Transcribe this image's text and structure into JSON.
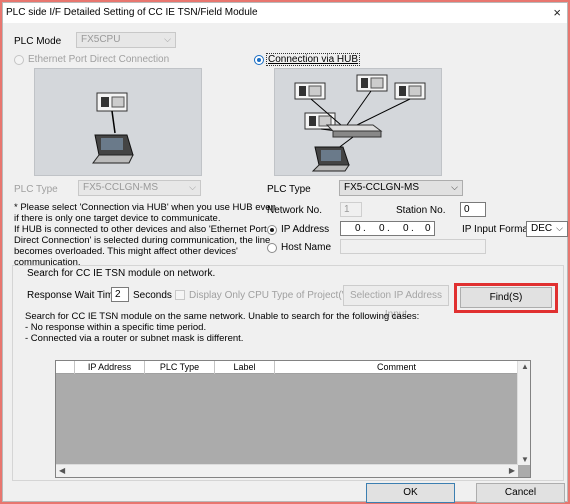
{
  "window": {
    "title": "PLC side I/F Detailed Setting of CC IE TSN/Field Module",
    "close_glyph": "×"
  },
  "plc_mode": {
    "label": "PLC Mode",
    "value": "FX5CPU"
  },
  "connection": {
    "direct_label": "Ethernet Port Direct Connection",
    "direct_selected": false,
    "hub_label": "Connection via HUB",
    "hub_selected": true
  },
  "left_plc_type": {
    "label": "PLC Type",
    "value": "FX5-CCLGN-MS"
  },
  "notice_text": "* Please select 'Connection via HUB' when you use HUB even\nif there is only one target device to communicate.\nIf HUB is connected to other devices and also 'Ethernet Port\nDirect Connection' is selected during communication, the line\nbecomes overloaded. This might affect other devices'\ncommunication.",
  "right_plc_type": {
    "label": "PLC Type",
    "value": "FX5-CCLGN-MS"
  },
  "network": {
    "network_no_label": "Network No.",
    "network_no_value": "1",
    "station_no_label": "Station No.",
    "station_no_value": "0",
    "ip_address_label": "IP Address",
    "ip_address_selected": true,
    "ip_octets": [
      "0",
      "0",
      "0",
      "0"
    ],
    "ip_input_format_label": "IP Input Format",
    "ip_input_format_value": "DEC",
    "host_name_label": "Host Name",
    "host_name_selected": false,
    "host_name_value": ""
  },
  "search": {
    "group_title": "Search for CC IE TSN module on network.",
    "response_wait_label": "Response Wait Time",
    "response_wait_value": "2",
    "seconds_label": "Seconds",
    "display_only_label": "Display Only CPU Type of Project(V)",
    "display_only_checked": false,
    "selection_ip_button": "Selection IP Address Input",
    "find_button": "Find(S)",
    "info_text": "Search for CC IE TSN module on the same network. Unable to search for the following cases:\n- No response within a specific time period.\n- Connected via a router or subnet mask is different."
  },
  "table": {
    "columns": [
      "",
      "IP Address",
      "PLC Type",
      "Label",
      "Comment"
    ],
    "rows": []
  },
  "footer": {
    "ok_button": "OK",
    "cancel_button": "Cancel"
  },
  "colors": {
    "highlight": "#e03030",
    "accent": "#1a6ec4",
    "window_bg": "#f0f0f0"
  }
}
